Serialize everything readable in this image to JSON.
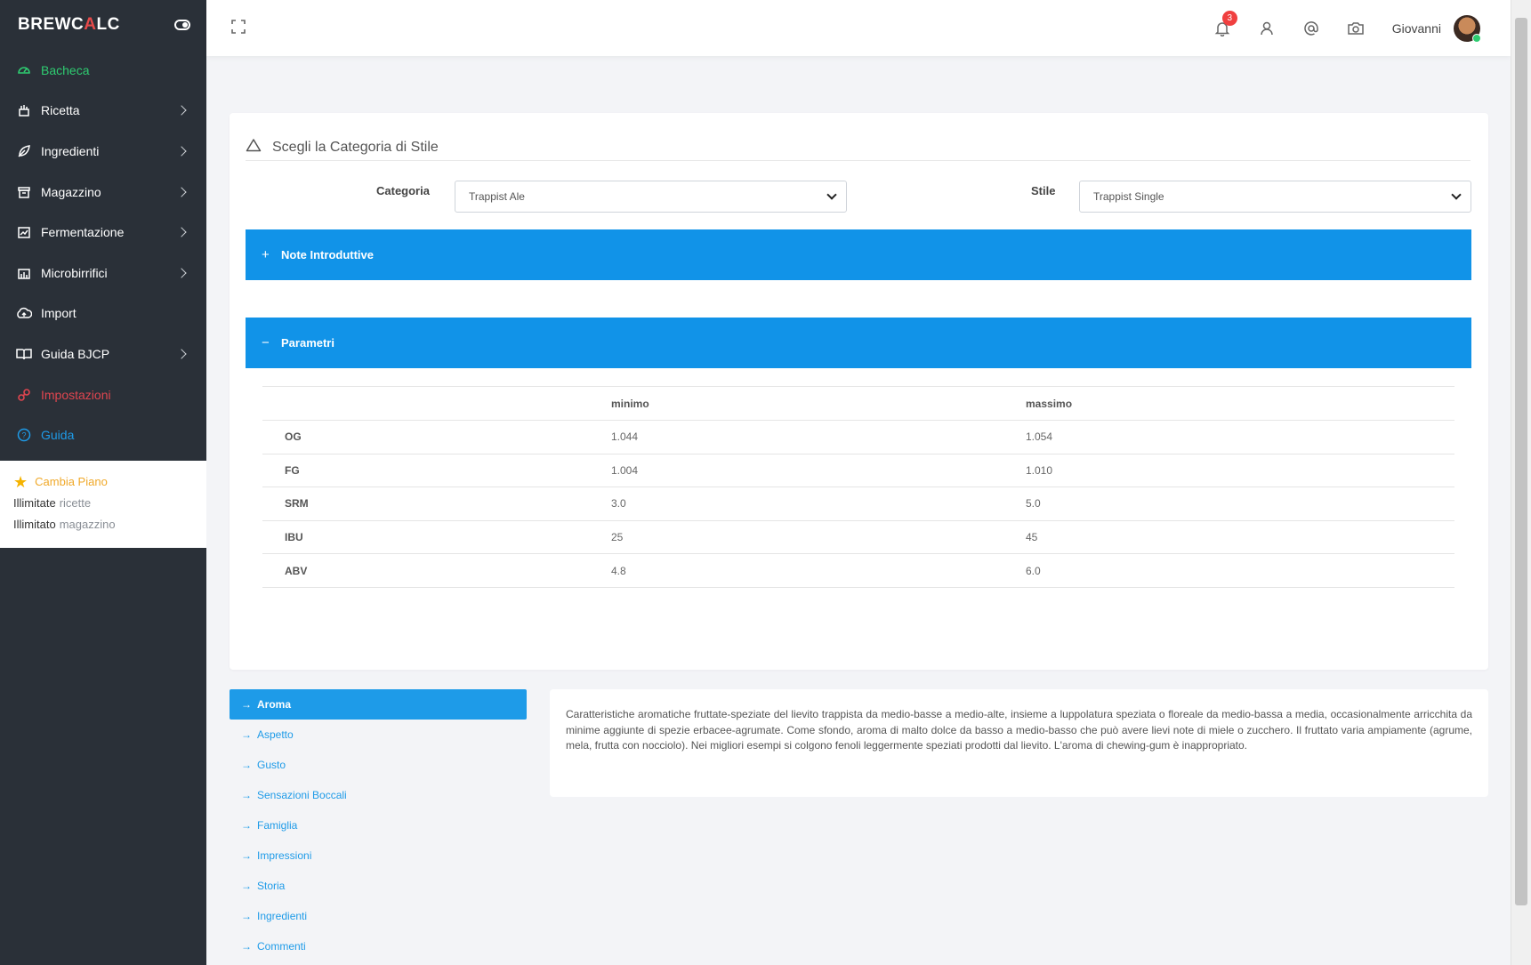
{
  "brand": {
    "part1": "BREWC",
    "accent": "A",
    "part2": "LC"
  },
  "sidebar": {
    "items": [
      {
        "label": "Bacheca",
        "icon": "dashboard-icon",
        "has_submenu": false,
        "color": "#2ecc71"
      },
      {
        "label": "Ricetta",
        "icon": "recipe-icon",
        "has_submenu": true
      },
      {
        "label": "Ingredienti",
        "icon": "leaf-icon",
        "has_submenu": true
      },
      {
        "label": "Magazzino",
        "icon": "warehouse-icon",
        "has_submenu": true
      },
      {
        "label": "Fermentazione",
        "icon": "fermentation-icon",
        "has_submenu": true
      },
      {
        "label": "Microbirrifici",
        "icon": "brewery-icon",
        "has_submenu": true
      },
      {
        "label": "Import",
        "icon": "cloud-upload-icon",
        "has_submenu": false
      },
      {
        "label": "Guida BJCP",
        "icon": "book-icon",
        "has_submenu": true
      },
      {
        "label": "Impostazioni",
        "icon": "link-icon",
        "has_submenu": false,
        "color": "#e0454f"
      },
      {
        "label": "Guida",
        "icon": "help-icon",
        "has_submenu": false,
        "color": "#1e9be8"
      }
    ],
    "plan": {
      "change_label": "Cambia Piano",
      "line1_bold": "Illimitate",
      "line1_light": "ricette",
      "line2_bold": "Illimitato",
      "line2_light": "magazzino"
    }
  },
  "topbar": {
    "notification_count": "3",
    "username": "Giovanni"
  },
  "style_chooser": {
    "title": "Scegli la Categoria di Stile",
    "category_label": "Categoria",
    "category_value": "Trappist Ale",
    "style_label": "Stile",
    "style_value": "Trappist Single"
  },
  "accordions": {
    "intro": {
      "sign": "+",
      "label": "Note Introduttive"
    },
    "params": {
      "sign": "−",
      "label": "Parametri"
    }
  },
  "params_table": {
    "headers": [
      "",
      "minimo",
      "massimo"
    ],
    "rows": [
      {
        "name": "OG",
        "min": "1.044",
        "max": "1.054"
      },
      {
        "name": "FG",
        "min": "1.004",
        "max": "1.010"
      },
      {
        "name": "SRM",
        "min": "3.0",
        "max": "5.0"
      },
      {
        "name": "IBU",
        "min": "25",
        "max": "45"
      },
      {
        "name": "ABV",
        "min": "4.8",
        "max": "6.0"
      }
    ]
  },
  "tabs": [
    {
      "label": "Aroma",
      "active": true
    },
    {
      "label": "Aspetto"
    },
    {
      "label": "Gusto"
    },
    {
      "label": "Sensazioni Boccali"
    },
    {
      "label": "Famiglia"
    },
    {
      "label": "Impressioni"
    },
    {
      "label": "Storia"
    },
    {
      "label": "Ingredienti"
    },
    {
      "label": "Commenti"
    }
  ],
  "tab_arrow": "→",
  "description": "Caratteristiche aromatiche fruttate-speziate del lievito trappista da medio-basse a medio-alte, insieme a luppolatura speziata o floreale da medio-bassa a media, occasionalmente arricchita da minime aggiunte di spezie erbacee-agrumate. Come sfondo, aroma di malto dolce da basso a medio-basso che può avere lievi note di miele o zucchero. Il fruttato varia ampiamente (agrume, mela, frutta con nocciolo). Nei migliori esempi si colgono fenoli leggermente speziati prodotti dal lievito. L'aroma di chewing-gum è inappropriato."
}
